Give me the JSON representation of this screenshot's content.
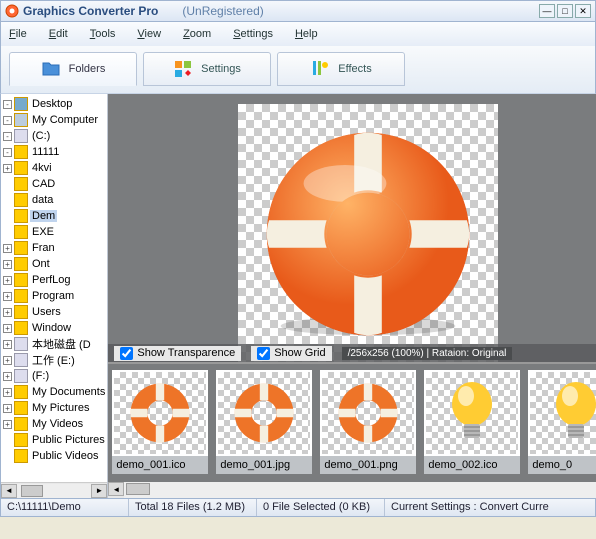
{
  "titlebar": {
    "app_name": "Graphics Converter Pro",
    "status": "(UnRegistered)"
  },
  "menu": [
    "File",
    "Edit",
    "Tools",
    "View",
    "Zoom",
    "Settings",
    "Help"
  ],
  "tabs": [
    {
      "label": "Folders",
      "icon": "folder-icon"
    },
    {
      "label": "Settings",
      "icon": "settings-icon"
    },
    {
      "label": "Effects",
      "icon": "effects-icon"
    }
  ],
  "tree": [
    {
      "indent": 0,
      "exp": "-",
      "icon": "desktop",
      "label": "Desktop"
    },
    {
      "indent": 0,
      "exp": "-",
      "icon": "comp",
      "label": "My Computer"
    },
    {
      "indent": 1,
      "exp": "-",
      "icon": "drive",
      "label": "(C:)"
    },
    {
      "indent": 2,
      "exp": "-",
      "icon": "folder",
      "label": "11111",
      "selected": false
    },
    {
      "indent": 3,
      "exp": "+",
      "icon": "folder",
      "label": "4kvi"
    },
    {
      "indent": 3,
      "exp": "",
      "icon": "folder",
      "label": "CAD"
    },
    {
      "indent": 3,
      "exp": "",
      "icon": "folder",
      "label": "data"
    },
    {
      "indent": 3,
      "exp": "",
      "icon": "folder",
      "label": "Dem",
      "selected": true
    },
    {
      "indent": 3,
      "exp": "",
      "icon": "folder",
      "label": "EXE"
    },
    {
      "indent": 3,
      "exp": "+",
      "icon": "folder",
      "label": "Fran"
    },
    {
      "indent": 3,
      "exp": "+",
      "icon": "folder",
      "label": "Ont"
    },
    {
      "indent": 2,
      "exp": "+",
      "icon": "folder",
      "label": "PerfLog"
    },
    {
      "indent": 2,
      "exp": "+",
      "icon": "folder",
      "label": "Program"
    },
    {
      "indent": 2,
      "exp": "+",
      "icon": "folder",
      "label": "Users"
    },
    {
      "indent": 2,
      "exp": "+",
      "icon": "folder",
      "label": "Window"
    },
    {
      "indent": 1,
      "exp": "+",
      "icon": "drive",
      "label": "本地磁盘 (D"
    },
    {
      "indent": 1,
      "exp": "+",
      "icon": "drive",
      "label": "工作 (E:)"
    },
    {
      "indent": 1,
      "exp": "+",
      "icon": "drive",
      "label": "(F:)"
    },
    {
      "indent": 0,
      "exp": "+",
      "icon": "folder",
      "label": "My Documents"
    },
    {
      "indent": 0,
      "exp": "+",
      "icon": "folder",
      "label": "My Pictures"
    },
    {
      "indent": 0,
      "exp": "+",
      "icon": "folder",
      "label": "My Videos"
    },
    {
      "indent": 0,
      "exp": "",
      "icon": "folder",
      "label": "Public Pictures"
    },
    {
      "indent": 0,
      "exp": "",
      "icon": "folder",
      "label": "Public Videos"
    }
  ],
  "preview_toolbar": {
    "show_transparence": "Show Transparence",
    "show_grid": "Show Grid",
    "info": "/256x256 (100%)  |  Rataion: Original"
  },
  "thumbnails": [
    {
      "name": "demo_001.ico",
      "kind": "ring"
    },
    {
      "name": "demo_001.jpg",
      "kind": "ring"
    },
    {
      "name": "demo_001.png",
      "kind": "ring"
    },
    {
      "name": "demo_002.ico",
      "kind": "bulb"
    },
    {
      "name": "demo_0",
      "kind": "bulb"
    }
  ],
  "statusbar": {
    "path": "C:\\11111\\Demo",
    "files": "Total 18 Files (1.2 MB)",
    "selected": "0 File Selected (0 KB)",
    "settings": "Current Settings : Convert Curre"
  }
}
